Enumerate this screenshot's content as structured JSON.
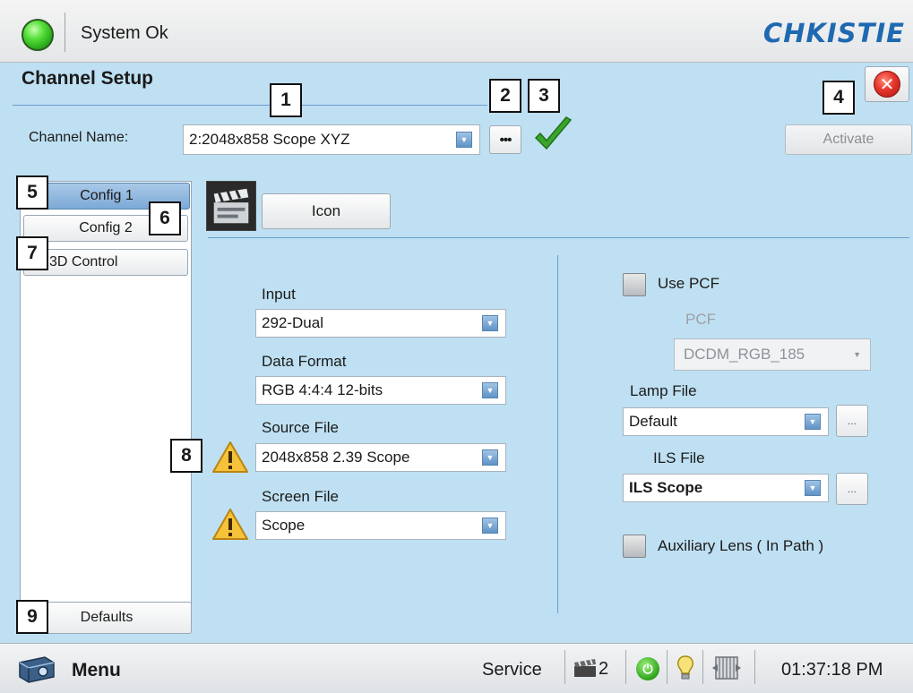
{
  "header": {
    "status_text": "System Ok",
    "brand": "CHKISTIE",
    "status_color": "#3ccf22",
    "brand_color": "#1f69b1"
  },
  "page": {
    "title": "Channel Setup"
  },
  "callouts": [
    "1",
    "2",
    "3",
    "4",
    "5",
    "6",
    "7",
    "8",
    "9"
  ],
  "channel": {
    "label": "Channel Name:",
    "value": "2:2048x858 Scope XYZ",
    "more_label": "•••",
    "activate_label": "Activate"
  },
  "tabs": [
    {
      "label": "Config 1",
      "selected": true
    },
    {
      "label": "Config 2"
    },
    {
      "label": "3D Control"
    }
  ],
  "defaults_label": "Defaults",
  "icon_button_label": "Icon",
  "fields": {
    "input": {
      "label": "Input",
      "value": "292-Dual"
    },
    "data_format": {
      "label": "Data Format",
      "value": "RGB 4:4:4 12-bits"
    },
    "source_file": {
      "label": "Source File",
      "value": "2048x858 2.39 Scope"
    },
    "screen_file": {
      "label": "Screen File",
      "value": "Scope"
    }
  },
  "right": {
    "use_pcf": {
      "label": "Use PCF",
      "checked": false
    },
    "pcf": {
      "label": "PCF",
      "value": "DCDM_RGB_185"
    },
    "lamp_file": {
      "label": "Lamp File",
      "value": "Default",
      "more_label": "..."
    },
    "ils_file": {
      "label": "ILS File",
      "value": "ILS Scope",
      "more_label": "..."
    },
    "aux_lens": {
      "label": "Auxiliary Lens ( In Path )",
      "checked": false
    }
  },
  "footer": {
    "menu_label": "Menu",
    "service_label": "Service",
    "channel_number": "2",
    "power_glyph": "⏻",
    "time": "01:37:18 PM"
  },
  "icons": [
    "status-led",
    "close-icon",
    "check-icon",
    "clapper-icon",
    "warning-icon",
    "projector-icon",
    "channel-icon",
    "power-icon",
    "bulb-icon",
    "shutter-icon",
    "dropdown-arrow-icon"
  ]
}
